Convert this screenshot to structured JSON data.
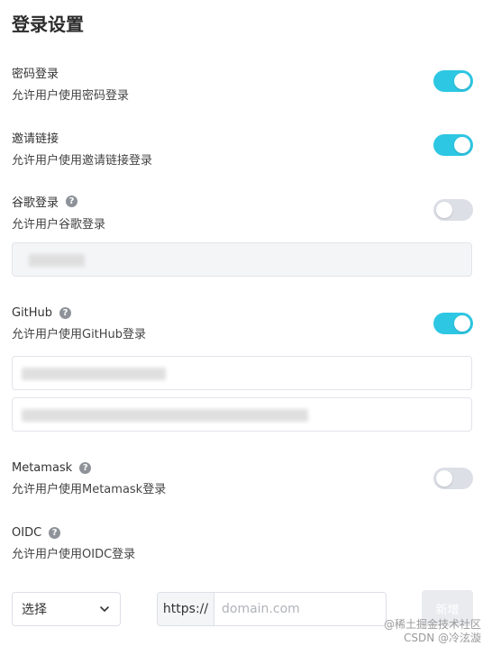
{
  "page": {
    "title": "登录设置"
  },
  "sections": {
    "password": {
      "title": "密码登录",
      "desc": "允许用户使用密码登录",
      "enabled": true
    },
    "invite": {
      "title": "邀请链接",
      "desc": "允许用户使用邀请链接登录",
      "enabled": true
    },
    "google": {
      "title": "谷歌登录",
      "desc": "允许用户谷歌登录",
      "enabled": false,
      "help_icon": "question-icon"
    },
    "github": {
      "title": "GitHub",
      "desc": "允许用户使用GitHub登录",
      "enabled": true,
      "help_icon": "question-icon"
    },
    "metamask": {
      "title": "Metamask",
      "desc": "允许用户使用Metamask登录",
      "enabled": false,
      "help_icon": "question-icon"
    },
    "oidc": {
      "title": "OIDC",
      "desc": "允许用户使用OIDC登录",
      "help_icon": "question-icon"
    }
  },
  "oidc_form": {
    "select_value": "选择",
    "url_prefix": "https://",
    "domain_placeholder": "domain.com",
    "add_label": "新增"
  },
  "watermark": {
    "line1": "@稀土掘金技术社区",
    "line2": "CSDN @冷泫漩"
  },
  "colors": {
    "toggle_on": "#2ec7e3",
    "toggle_off": "#dcdfe6"
  }
}
